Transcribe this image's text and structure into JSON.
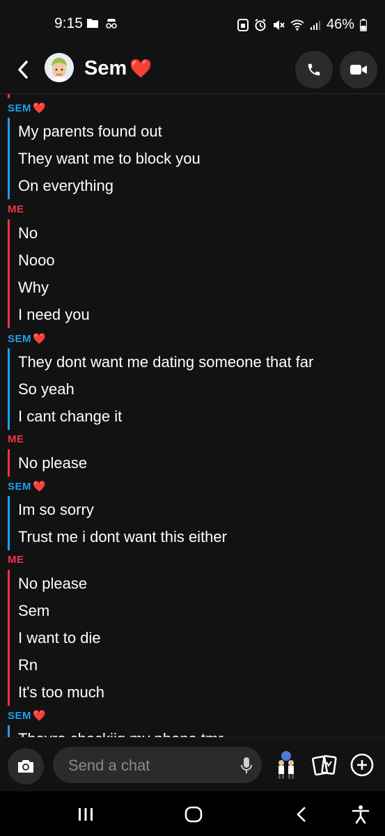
{
  "status_bar": {
    "time": "9:15",
    "battery": "46%"
  },
  "header": {
    "contact_name": "Sem",
    "contact_emoji": "❤️"
  },
  "chat": {
    "sender_sem": "SEM",
    "sender_me": "ME",
    "groups": [
      {
        "sender": "sem",
        "messages": [
          "My parents found out",
          "They want me to block you",
          "On everything"
        ]
      },
      {
        "sender": "me",
        "messages": [
          "No",
          "Nooo",
          "Why",
          "I need you"
        ]
      },
      {
        "sender": "sem",
        "messages": [
          "They dont want me dating someone that far",
          "So yeah",
          "I cant change it"
        ]
      },
      {
        "sender": "me",
        "messages": [
          "No please"
        ]
      },
      {
        "sender": "sem",
        "messages": [
          "Im so sorry",
          "Trust me i dont want this either"
        ]
      },
      {
        "sender": "me",
        "messages": [
          "No please",
          "Sem",
          "I want to die",
          "Rn",
          "It's too much"
        ]
      },
      {
        "sender": "sem",
        "messages": [
          "Theyre checkiig my phone tmr"
        ]
      }
    ]
  },
  "composer": {
    "placeholder": "Send a chat"
  },
  "colors": {
    "sem": "#1ea0f0",
    "me": "#f2334a",
    "background": "#121212"
  }
}
